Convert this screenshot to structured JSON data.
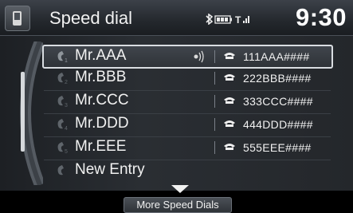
{
  "header": {
    "title": "Speed dial",
    "time": "9:30",
    "icons": [
      "phone-tab-icon",
      "bluetooth-icon",
      "battery-icon",
      "signal-icon"
    ]
  },
  "entries": [
    {
      "name": "Mr.AAA",
      "number": "111AAA####",
      "voice_tag": true
    },
    {
      "name": "Mr.BBB",
      "number": "222BBB####",
      "voice_tag": false
    },
    {
      "name": "Mr.CCC",
      "number": "333CCC####",
      "voice_tag": false
    },
    {
      "name": "Mr.DDD",
      "number": "444DDD####",
      "voice_tag": false
    },
    {
      "name": "Mr.EEE",
      "number": "555EEE####",
      "voice_tag": false
    }
  ],
  "new_entry_label": "New Entry",
  "footer": {
    "more_label": "More Speed Dials"
  },
  "colors": {
    "text": "#f1f1f1",
    "selected_border": "#d9dde1",
    "background": "#000000"
  }
}
